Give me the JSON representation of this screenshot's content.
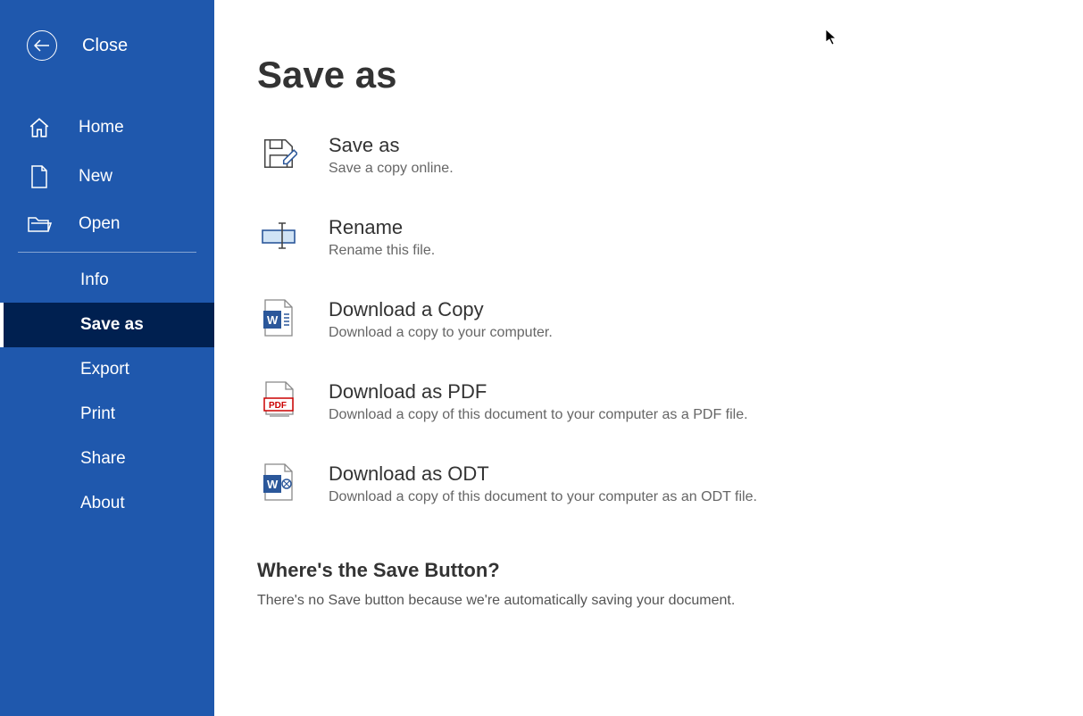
{
  "colors": {
    "sidebar_bg": "#1f58ad",
    "selected_bg": "#002050",
    "accent": "#2b579a",
    "text_primary": "#333",
    "text_secondary": "#666"
  },
  "sidebar": {
    "close_label": "Close",
    "items_top": [
      {
        "icon": "home-icon",
        "label": "Home"
      },
      {
        "icon": "new-icon",
        "label": "New"
      },
      {
        "icon": "open-icon",
        "label": "Open"
      }
    ],
    "items_bottom": [
      {
        "label": "Info"
      },
      {
        "label": "Save as",
        "selected": true
      },
      {
        "label": "Export"
      },
      {
        "label": "Print"
      },
      {
        "label": "Share"
      },
      {
        "label": "About"
      }
    ]
  },
  "page": {
    "title": "Save as",
    "options": [
      {
        "icon": "save-as-icon",
        "title": "Save as",
        "desc": "Save a copy online."
      },
      {
        "icon": "rename-icon",
        "title": "Rename",
        "desc": "Rename this file."
      },
      {
        "icon": "word-doc-icon",
        "title": "Download a Copy",
        "desc": "Download a copy to your computer."
      },
      {
        "icon": "pdf-icon",
        "title": "Download as PDF",
        "desc": "Download a copy of this document to your computer as a PDF file."
      },
      {
        "icon": "odt-icon",
        "title": "Download as ODT",
        "desc": "Download a copy of this document to your computer as an ODT file."
      }
    ],
    "footer": {
      "title": "Where's the Save Button?",
      "text": "There's no Save button because we're automatically saving your document."
    }
  }
}
